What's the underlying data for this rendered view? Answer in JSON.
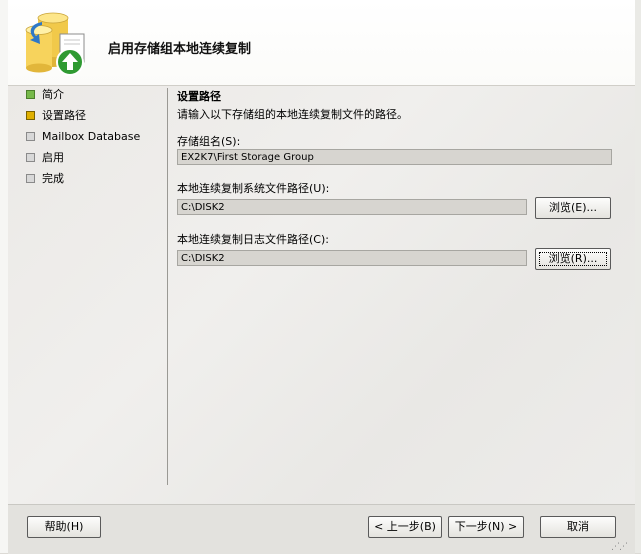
{
  "window": {
    "title": "启用存储组本地连续复制"
  },
  "nav": {
    "items": [
      {
        "label": "简介",
        "state": "done"
      },
      {
        "label": "设置路径",
        "state": "current"
      },
      {
        "label": "Mailbox Database",
        "state": "pending"
      },
      {
        "label": "启用",
        "state": "pending"
      },
      {
        "label": "完成",
        "state": "pending"
      }
    ]
  },
  "content": {
    "title": "设置路径",
    "description": "请输入以下存储组的本地连续复制文件的路径。",
    "storage_group_label": "存储组名(S):",
    "storage_group_value": "EX2K7\\First Storage Group",
    "system_path_label": "本地连续复制系统文件路径(U):",
    "system_path_value": "C:\\DISK2",
    "system_browse_label": "浏览(E)...",
    "log_path_label": "本地连续复制日志文件路径(C):",
    "log_path_value": "C:\\DISK2",
    "log_browse_label": "浏览(R)..."
  },
  "footer": {
    "help_label": "帮助(H)",
    "back_label": "< 上一步(B)",
    "next_label": "下一步(N) >",
    "cancel_label": "取消"
  },
  "colors": {
    "done_bullet": "#77b94a",
    "current_bullet": "#e0b000",
    "pending_bullet": "#d8d8d8"
  }
}
